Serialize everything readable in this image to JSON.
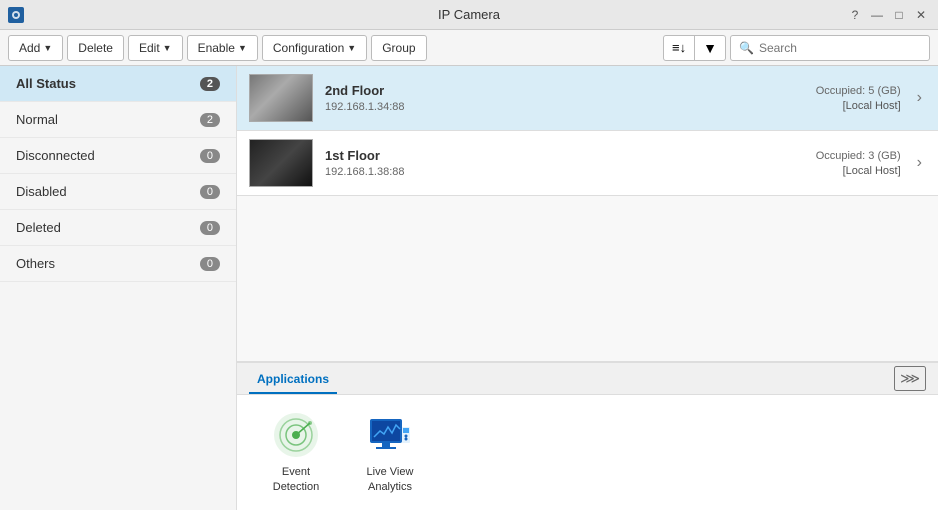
{
  "titleBar": {
    "title": "IP Camera",
    "controls": {
      "help": "?",
      "minimize": "—",
      "restore": "□",
      "close": "✕"
    }
  },
  "toolbar": {
    "add_label": "Add",
    "delete_label": "Delete",
    "edit_label": "Edit",
    "enable_label": "Enable",
    "configuration_label": "Configuration",
    "group_label": "Group",
    "search_placeholder": "Search"
  },
  "sidebar": {
    "items": [
      {
        "id": "all-status",
        "label": "All Status",
        "count": "2",
        "active": true
      },
      {
        "id": "normal",
        "label": "Normal",
        "count": "2",
        "active": false
      },
      {
        "id": "disconnected",
        "label": "Disconnected",
        "count": "0",
        "active": false
      },
      {
        "id": "disabled",
        "label": "Disabled",
        "count": "0",
        "active": false
      },
      {
        "id": "deleted",
        "label": "Deleted",
        "count": "0",
        "active": false
      },
      {
        "id": "others",
        "label": "Others",
        "count": "0",
        "active": false
      }
    ]
  },
  "cameras": [
    {
      "id": "cam1",
      "name": "2nd Floor",
      "ip": "192.168.1.34:88",
      "storage": "Occupied: 5 (GB)",
      "host": "[Local Host]",
      "selected": true,
      "thumbnailStyle": "light"
    },
    {
      "id": "cam2",
      "name": "1st Floor",
      "ip": "192.168.1.38:88",
      "storage": "Occupied: 3 (GB)",
      "host": "[Local Host]",
      "selected": false,
      "thumbnailStyle": "dark"
    }
  ],
  "applications": {
    "tab_label": "Applications",
    "collapse_icon": "⋙",
    "items": [
      {
        "id": "event-detection",
        "label": "Event Detection"
      },
      {
        "id": "live-analytics",
        "label": "Live View\nAnalytics"
      }
    ]
  }
}
